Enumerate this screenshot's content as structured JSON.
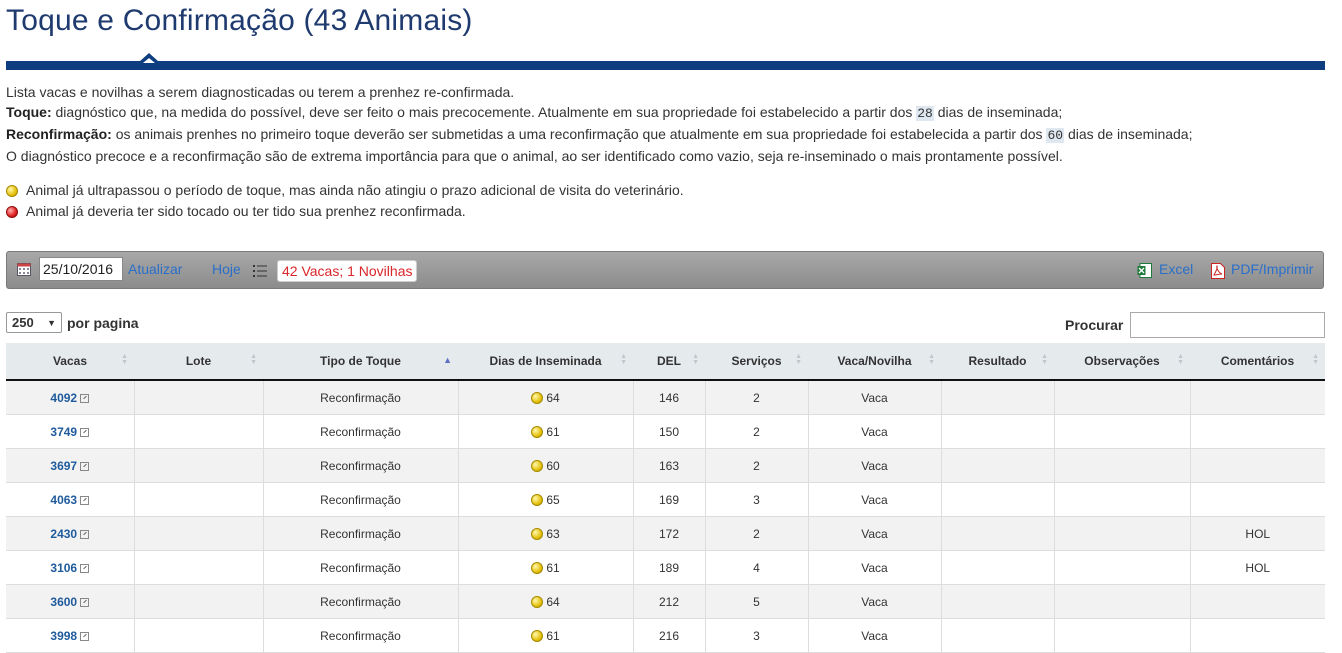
{
  "page": {
    "title": "Toque e Confirmação (43 Animais)"
  },
  "description": {
    "line1": "Lista vacas e novilhas a serem diagnosticadas ou terem a prenhez re-confirmada.",
    "toque_label": "Toque:",
    "toque_text_a": " diagnóstico que, na medida do possível, deve ser feito o mais precocemente. Atualmente em sua propriedade foi estabelecido a partir dos ",
    "toque_days": "28",
    "toque_text_b": " dias de inseminada;",
    "reconf_label": "Reconfirmação:",
    "reconf_text_a": " os animais prenhes no primeiro toque deverão ser submetidas a uma reconfirmação que atualmente em sua propriedade foi estabelecida a partir dos ",
    "reconf_days": "60",
    "reconf_text_b": " dias de inseminada;",
    "line4": "O diagnóstico precoce e a reconfirmação são de extrema importância para que o animal, ao ser identificado como vazio, seja re-inseminado o mais prontamente possível."
  },
  "legend": {
    "yellow": "Animal já ultrapassou o período de toque, mas ainda não atingiu o prazo adicional de visita do veterinário.",
    "red": "Animal já deveria ter sido tocado ou ter tido sua prenhez reconfirmada."
  },
  "toolbar": {
    "date_value": "25/10/2016",
    "atualizar_label": "Atualizar",
    "hoje_label": "Hoje",
    "count_badge": "42 Vacas; 1 Novilhas",
    "excel_label": "Excel",
    "pdf_label": "PDF/Imprimir",
    "calendar_icon": "calendar-icon",
    "list_icon": "list-icon",
    "excel_icon": "excel-icon",
    "pdf_icon": "pdf-icon"
  },
  "controls": {
    "per_page_value": "250",
    "per_page_label": "por pagina",
    "search_label": "Procurar",
    "search_value": ""
  },
  "colors": {
    "title": "#1e3a6e",
    "bar": "#0e3d80",
    "link": "#2a6fc9",
    "badge": "#d9262a"
  },
  "table": {
    "headers": [
      "Vacas",
      "Lote",
      "Tipo de Toque",
      "Dias de Inseminada",
      "DEL",
      "Serviços",
      "Vaca/Novilha",
      "Resultado",
      "Observações",
      "Comentários"
    ],
    "sorted_column": "Tipo de Toque",
    "rows": [
      {
        "vaca": "4092",
        "lote": "",
        "tipo": "Reconfirmação",
        "dias": "64",
        "status": "yellow",
        "del": "146",
        "servicos": "2",
        "vn": "Vaca",
        "resultado": "",
        "obs": "",
        "coment": ""
      },
      {
        "vaca": "3749",
        "lote": "",
        "tipo": "Reconfirmação",
        "dias": "61",
        "status": "yellow",
        "del": "150",
        "servicos": "2",
        "vn": "Vaca",
        "resultado": "",
        "obs": "",
        "coment": ""
      },
      {
        "vaca": "3697",
        "lote": "",
        "tipo": "Reconfirmação",
        "dias": "60",
        "status": "yellow",
        "del": "163",
        "servicos": "2",
        "vn": "Vaca",
        "resultado": "",
        "obs": "",
        "coment": ""
      },
      {
        "vaca": "4063",
        "lote": "",
        "tipo": "Reconfirmação",
        "dias": "65",
        "status": "yellow",
        "del": "169",
        "servicos": "3",
        "vn": "Vaca",
        "resultado": "",
        "obs": "",
        "coment": ""
      },
      {
        "vaca": "2430",
        "lote": "",
        "tipo": "Reconfirmação",
        "dias": "63",
        "status": "yellow",
        "del": "172",
        "servicos": "2",
        "vn": "Vaca",
        "resultado": "",
        "obs": "",
        "coment": "HOL"
      },
      {
        "vaca": "3106",
        "lote": "",
        "tipo": "Reconfirmação",
        "dias": "61",
        "status": "yellow",
        "del": "189",
        "servicos": "4",
        "vn": "Vaca",
        "resultado": "",
        "obs": "",
        "coment": "HOL"
      },
      {
        "vaca": "3600",
        "lote": "",
        "tipo": "Reconfirmação",
        "dias": "64",
        "status": "yellow",
        "del": "212",
        "servicos": "5",
        "vn": "Vaca",
        "resultado": "",
        "obs": "",
        "coment": ""
      },
      {
        "vaca": "3998",
        "lote": "",
        "tipo": "Reconfirmação",
        "dias": "61",
        "status": "yellow",
        "del": "216",
        "servicos": "3",
        "vn": "Vaca",
        "resultado": "",
        "obs": "",
        "coment": ""
      }
    ]
  }
}
